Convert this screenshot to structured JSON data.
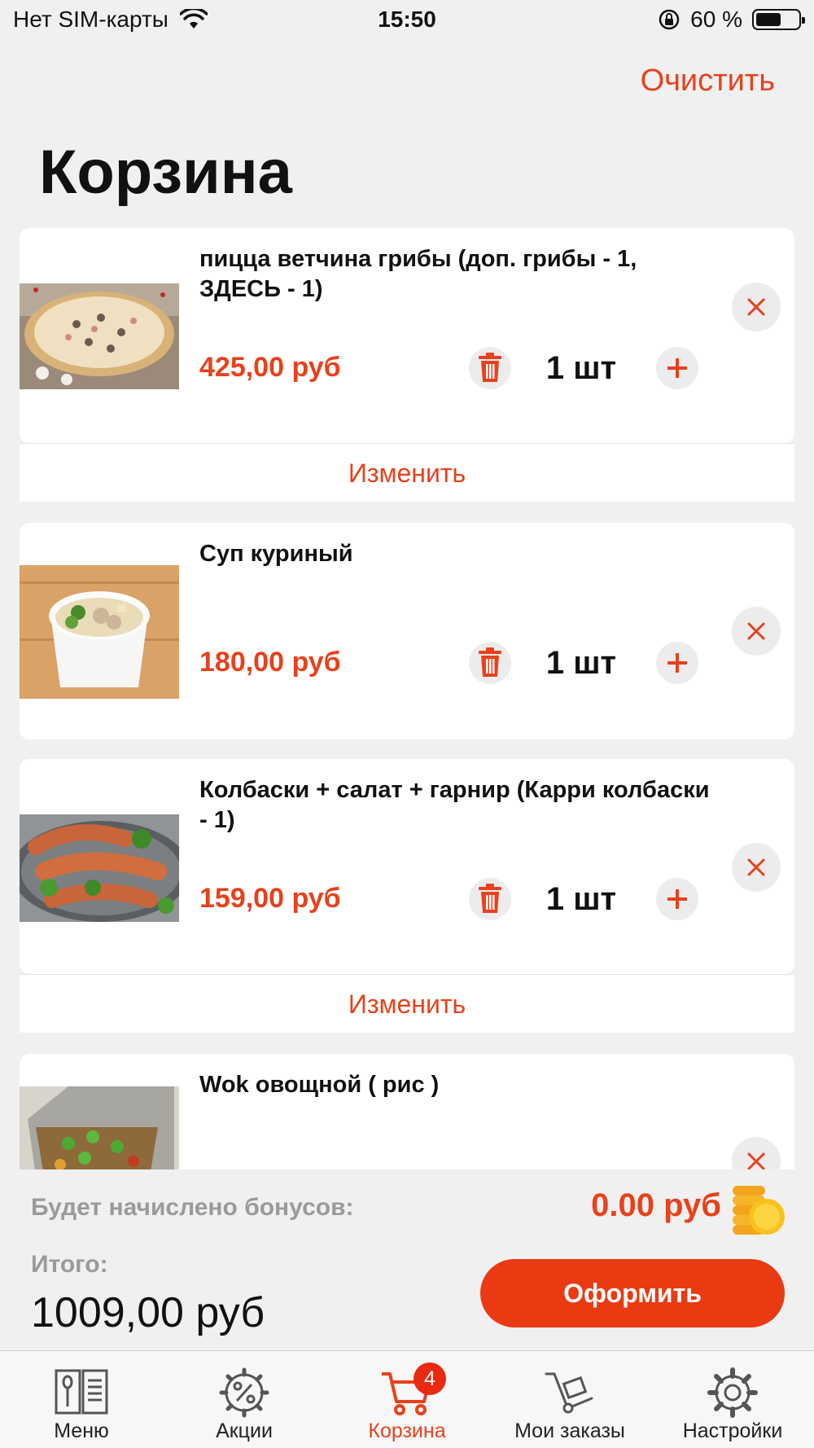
{
  "status_bar": {
    "carrier": "Нет SIM-карты",
    "time": "15:50",
    "battery": "60 %",
    "battery_level": 0.6
  },
  "header": {
    "clear_label": "Очистить",
    "title": "Корзина"
  },
  "cart": {
    "items": [
      {
        "title": "пицца ветчина грибы (доп. грибы  - 1, ЗДЕСЬ  - 1)",
        "price": "425,00 руб",
        "qty": "1 шт",
        "image": "pizza-photo",
        "edit_label": "Изменить"
      },
      {
        "title": "Суп куриный",
        "price": "180,00 руб",
        "qty": "1 шт",
        "image": "soup-photo"
      },
      {
        "title": "Колбаски + салат + гарнир (Карри колбаски - 1)",
        "price": "159,00 руб",
        "qty": "1 шт",
        "image": "sausages-photo",
        "edit_label": "Изменить"
      },
      {
        "title": "Wok овощной   ( рис )",
        "image": "wok-photo"
      }
    ]
  },
  "summary": {
    "bonus_label": "Будет начислено бонусов:",
    "bonus_value": "0.00 руб",
    "total_label": "Итого:",
    "total_value": "1009,00 руб",
    "checkout_label": "Оформить"
  },
  "tabs": [
    {
      "label": "Меню",
      "icon": "menu-book-icon"
    },
    {
      "label": "Акции",
      "icon": "percent-gear-icon"
    },
    {
      "label": "Корзина",
      "icon": "cart-icon",
      "badge": "4",
      "active": true
    },
    {
      "label": "Мои заказы",
      "icon": "hand-truck-icon"
    },
    {
      "label": "Настройки",
      "icon": "gear-icon"
    }
  ],
  "colors": {
    "accent": "#e8411c",
    "button": "#ea3a12",
    "background": "#f0f0f0"
  }
}
